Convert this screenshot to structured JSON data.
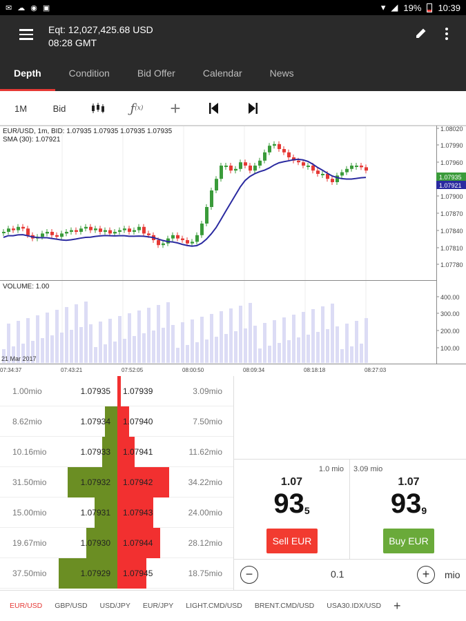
{
  "status": {
    "battery": "19%",
    "time": "10:39"
  },
  "header": {
    "equity": "Eqt: 12,027,425.68 USD",
    "time": "08:28 GMT"
  },
  "tabs": [
    "Depth",
    "Condition",
    "Bid Offer",
    "Calendar",
    "News"
  ],
  "toolbar": {
    "timeframe": "1M",
    "price_type": "Bid"
  },
  "chart": {
    "info_line1": "EUR/USD, 1m, BID: 1.07935 1.07935 1.07935 1.07935",
    "info_line2": "SMA (30): 1.07921",
    "volume_label": "VOLUME: 1.00",
    "date_label": "21 Mar 2017",
    "price_ticks": [
      "1.08020",
      "1.07990",
      "1.07960",
      "1.07935",
      "1.07921",
      "1.07900",
      "1.07870",
      "1.07840",
      "1.07810",
      "1.07780"
    ],
    "volume_ticks": [
      "400.00",
      "300.00",
      "200.00",
      "100.00"
    ],
    "time_ticks": [
      "07:34:37",
      "07:43:21",
      "07:52:05",
      "08:00:50",
      "08:09:34",
      "08:18:18",
      "08:27:03"
    ],
    "last_price_tag": "1.07935",
    "sma_tag": "1.07921",
    "colors": {
      "up": "#3a9b3a",
      "down": "#e53935",
      "sma": "#2a2aa0",
      "volume": "#dcdcf5"
    }
  },
  "depth": [
    {
      "bid_vol": "1.00mio",
      "bid": "1.07935",
      "ask": "1.07939",
      "ask_vol": "3.09mio",
      "bid_frac": 0.0,
      "ask_frac": 0.05
    },
    {
      "bid_vol": "8.62mio",
      "bid": "1.07934",
      "ask": "1.07940",
      "ask_vol": "7.50mio",
      "bid_frac": 0.18,
      "ask_frac": 0.17
    },
    {
      "bid_vol": "10.16mio",
      "bid": "1.07933",
      "ask": "1.07941",
      "ask_vol": "11.62mio",
      "bid_frac": 0.22,
      "ask_frac": 0.25
    },
    {
      "bid_vol": "31.50mio",
      "bid": "1.07932",
      "ask": "1.07942",
      "ask_vol": "34.22mio",
      "bid_frac": 0.72,
      "ask_frac": 0.75
    },
    {
      "bid_vol": "15.00mio",
      "bid": "1.07931",
      "ask": "1.07943",
      "ask_vol": "24.00mio",
      "bid_frac": 0.33,
      "ask_frac": 0.52
    },
    {
      "bid_vol": "19.67mio",
      "bid": "1.07930",
      "ask": "1.07944",
      "ask_vol": "28.12mio",
      "bid_frac": 0.45,
      "ask_frac": 0.62
    },
    {
      "bid_vol": "37.50mio",
      "bid": "1.07929",
      "ask": "1.07945",
      "ask_vol": "18.75mio",
      "bid_frac": 0.85,
      "ask_frac": 0.42
    }
  ],
  "trade": {
    "sell": {
      "size": "1.0 mio",
      "big": "1.07",
      "pips": "93",
      "frac": "5",
      "label": "Sell EUR"
    },
    "buy": {
      "size": "3.09 mio",
      "big": "1.07",
      "pips": "93",
      "frac": "9",
      "label": "Buy EUR"
    },
    "quantity": "0.1",
    "unit": "mio"
  },
  "pairs": [
    "EUR/USD",
    "GBP/USD",
    "USD/JPY",
    "EUR/JPY",
    "LIGHT.CMD/USD",
    "BRENT.CMD/USD",
    "USA30.IDX/USD"
  ]
}
